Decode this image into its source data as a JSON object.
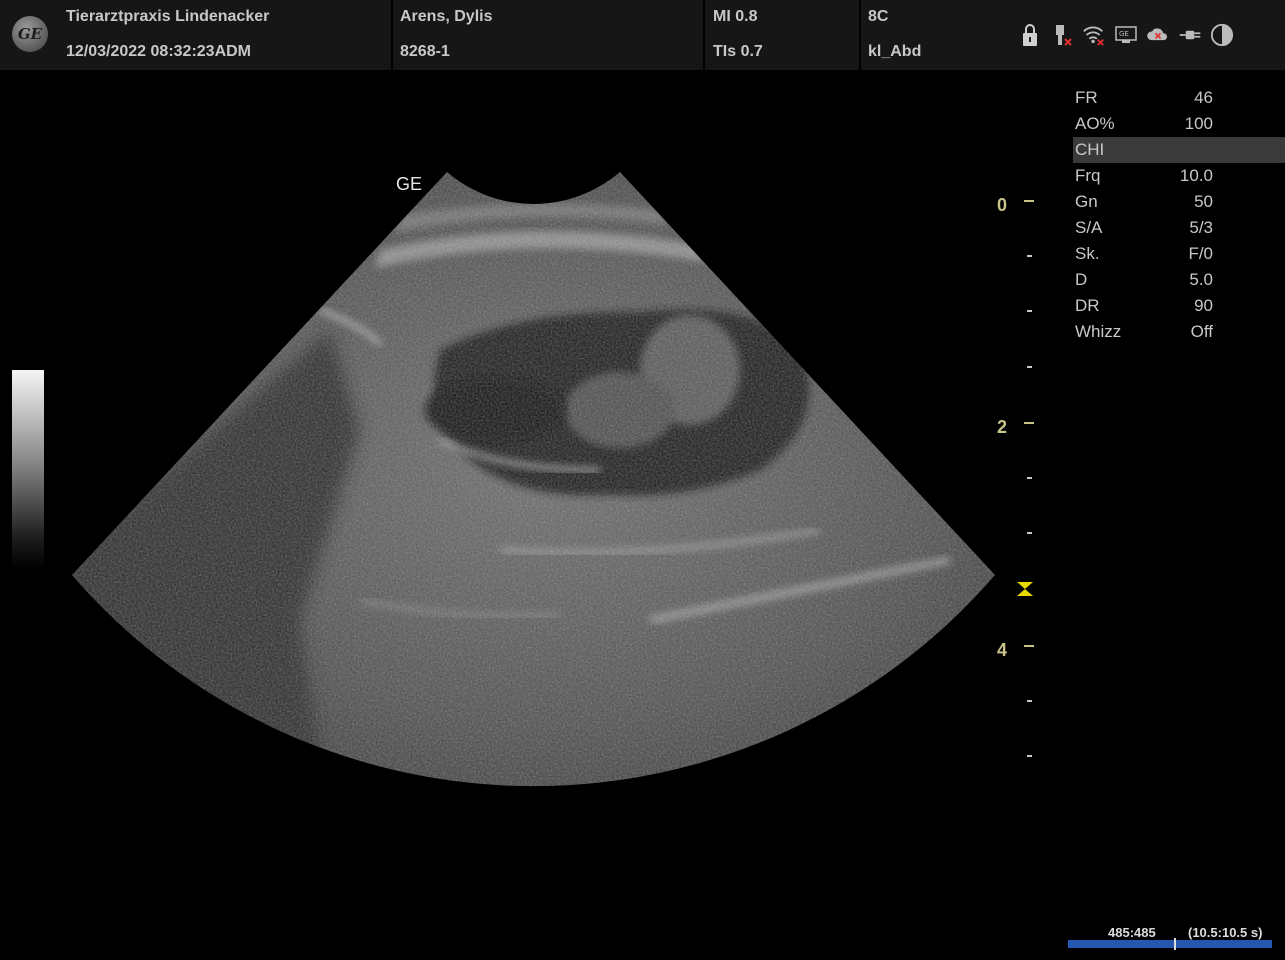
{
  "header": {
    "logo_text": "GE",
    "clinic": "Tierarztpraxis Lindenacker",
    "datetime": "12/03/2022 08:32:23ADM",
    "patient_name": "Arens, Dylis",
    "patient_id": "8268-1",
    "mi": "MI 0.8",
    "tis": "TIs 0.7",
    "probe": "8C",
    "preset": "kl_Abd",
    "status_icons": [
      "lock-icon",
      "usb-icon",
      "wifi-icon",
      "network-icon",
      "cloud-icon",
      "plug-icon",
      "contrast-icon"
    ]
  },
  "params": [
    {
      "label": "FR",
      "value": "46"
    },
    {
      "label": "AO%",
      "value": "100"
    },
    {
      "label": "CHI",
      "value": "",
      "highlight": true
    },
    {
      "label": "Frq",
      "value": "10.0"
    },
    {
      "label": "Gn",
      "value": "50"
    },
    {
      "label": "S/A",
      "value": "5/3"
    },
    {
      "label": "Sk.",
      "value": "F/0"
    },
    {
      "label": "D",
      "value": "5.0"
    },
    {
      "label": "DR",
      "value": "90"
    },
    {
      "label": "Whizz",
      "value": "Off"
    }
  ],
  "image": {
    "orientation_label": "GE"
  },
  "depth_scale": {
    "labels": [
      "0",
      "2",
      "4"
    ]
  },
  "cine": {
    "frames": "485:485",
    "time": "(10.5:10.5 s)"
  },
  "colors": {
    "depth_label": "#c9c48a",
    "focus_marker": "#e8d800",
    "cine_bar": "#2457b0"
  }
}
